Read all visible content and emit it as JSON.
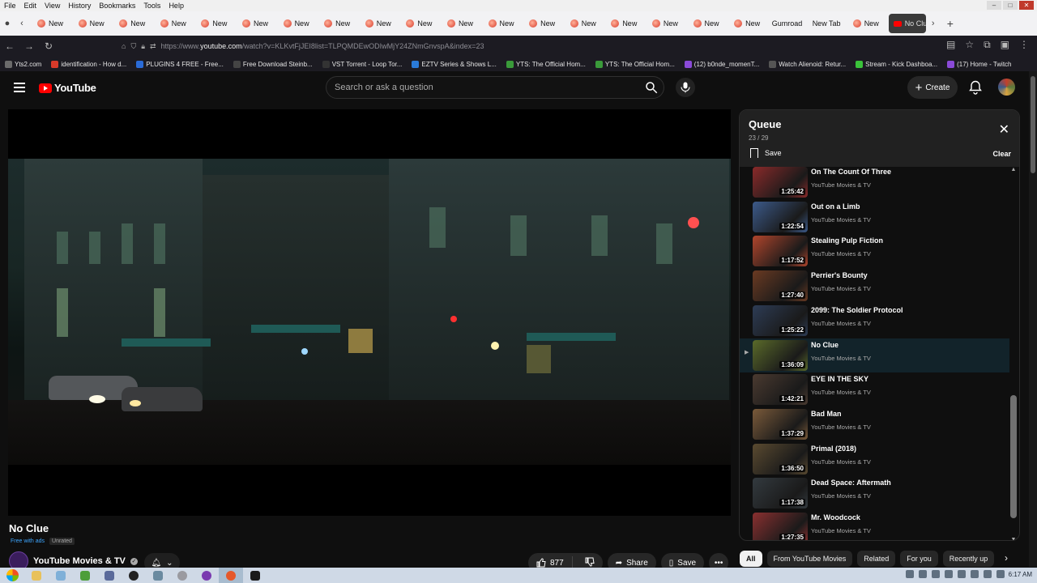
{
  "browser": {
    "menu": [
      "File",
      "Edit",
      "View",
      "History",
      "Bookmarks",
      "Tools",
      "Help"
    ],
    "tabs": [
      "New",
      "New",
      "New",
      "New",
      "New",
      "New",
      "New",
      "New",
      "New",
      "New",
      "New",
      "New",
      "New",
      "New",
      "New",
      "New",
      "New",
      "New"
    ],
    "tab_gumroad": "Gumroad",
    "tab_newtab": "New Tab",
    "tab_last": "New",
    "active_tab": "No Clue",
    "url_prefix": "https://www.",
    "url_domain": "youtube.com",
    "url_rest": "/watch?v=KLKvtFjJEI8list=TLPQMDEwODIwMjY24ZNmGnvspA&index=23",
    "bookmarks": [
      "Yts2.com",
      "identification - How d...",
      "PLUGINS 4 FREE - Free...",
      "Free Download Steinb...",
      "VST Torrent - Loop Tor...",
      "EZTV Series & Shows L...",
      "YTS: The Official Hom...",
      "YTS: The Official Hom...",
      "(12) b0nde_momenT...",
      "Watch Alienoid: Retur...",
      "Stream - Kick Dashboa...",
      "(17) Home - Twitch"
    ]
  },
  "masthead": {
    "logo_text": "YouTube",
    "search_placeholder": "Search or ask a question",
    "create_label": "Create"
  },
  "video": {
    "title": "No Clue",
    "badge_free": "Free with ads",
    "badge_rating": "Unrated",
    "channel": "YouTube Movies & TV",
    "likes": "877",
    "share_label": "Share",
    "save_label": "Save"
  },
  "queue": {
    "title": "Queue",
    "position": "23 / 29",
    "save_label": "Save",
    "clear_label": "Clear",
    "items": [
      {
        "title": "On The Count Of Three",
        "channel": "YouTube Movies & TV",
        "duration": "1:25:42",
        "color": "#8a2a2a",
        "active": false
      },
      {
        "title": "Out on a Limb",
        "channel": "YouTube Movies & TV",
        "duration": "1:22:54",
        "color": "#3c5a8a",
        "active": false
      },
      {
        "title": "Stealing Pulp Fiction",
        "channel": "YouTube Movies & TV",
        "duration": "1:17:52",
        "color": "#b0452c",
        "active": false
      },
      {
        "title": "Perrier's Bounty",
        "channel": "YouTube Movies & TV",
        "duration": "1:27:40",
        "color": "#6a3a22",
        "active": false
      },
      {
        "title": "2099: The Soldier Protocol",
        "channel": "YouTube Movies & TV",
        "duration": "1:25:22",
        "color": "#2d3c55",
        "active": false
      },
      {
        "title": "No Clue",
        "channel": "YouTube Movies & TV",
        "duration": "1:36:09",
        "color": "#5a6a2a",
        "active": true
      },
      {
        "title": "EYE IN THE SKY",
        "channel": "YouTube Movies & TV",
        "duration": "1:42:21",
        "color": "#4a3a30",
        "active": false
      },
      {
        "title": "Bad Man",
        "channel": "YouTube Movies & TV",
        "duration": "1:37:29",
        "color": "#7a5a3a",
        "active": false
      },
      {
        "title": "Primal (2018)",
        "channel": "YouTube Movies & TV",
        "duration": "1:36:50",
        "color": "#5a4a30",
        "active": false
      },
      {
        "title": "Dead Space: Aftermath",
        "channel": "YouTube Movies & TV",
        "duration": "1:17:38",
        "color": "#333a3f",
        "active": false
      },
      {
        "title": "Mr. Woodcock",
        "channel": "YouTube Movies & TV",
        "duration": "1:27:35",
        "color": "#8a3030",
        "active": false
      }
    ]
  },
  "chips": [
    "All",
    "From YouTube Movies",
    "Related",
    "For you",
    "Recently up"
  ],
  "taskbar": {
    "clock": "6:17 AM"
  },
  "colors": {
    "brand_red": "#ff0000",
    "link_blue": "#3ea6ff",
    "background": "#0f0f0f"
  }
}
